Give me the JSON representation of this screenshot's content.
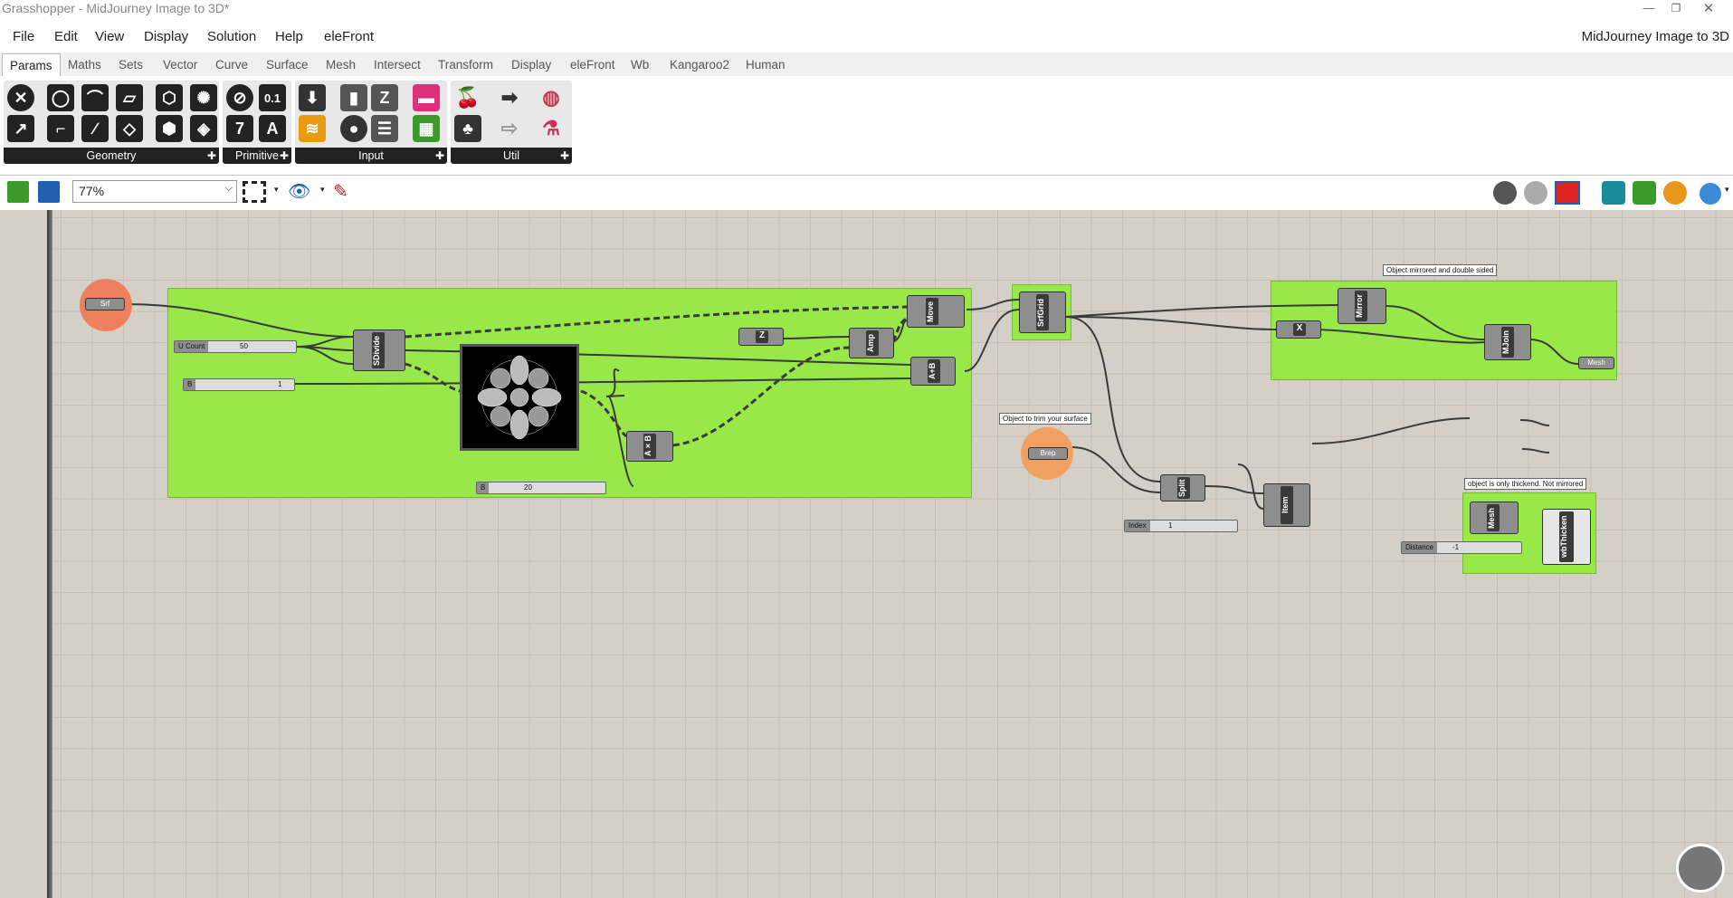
{
  "window": {
    "title": "Grasshopper - MidJourney Image to 3D*",
    "doc_name": "MidJourney Image to 3D"
  },
  "menu": [
    "File",
    "Edit",
    "View",
    "Display",
    "Solution",
    "Help",
    "eleFront"
  ],
  "tabs": [
    "Params",
    "Maths",
    "Sets",
    "Vector",
    "Curve",
    "Surface",
    "Mesh",
    "Intersect",
    "Transform",
    "Display",
    "eleFront",
    "Wb",
    "Kangaroo2",
    "Human"
  ],
  "ribbon": {
    "groups": [
      "Geometry",
      "Primitive",
      "Input",
      "Util"
    ],
    "primitive_numeric_icon": "0.1",
    "primitive_text_icon": "A",
    "primitive_integer_icon": "7"
  },
  "toolbar": {
    "zoom": "77%"
  },
  "canvas": {
    "srf_param": "Srf",
    "brep_param": "Brep",
    "notes": [
      "Object mirrored and double sided",
      "Object to trim your surface",
      "object is only thickend. Not mirrored"
    ],
    "sliders": [
      {
        "label": "U Count",
        "value": "50"
      },
      {
        "label": "B",
        "value": "1"
      },
      {
        "label": "B",
        "value": "20"
      },
      {
        "label": "Index",
        "value": "1"
      },
      {
        "label": "Distance",
        "value": "-1"
      }
    ],
    "components": {
      "sdivide": "SDivide",
      "z": "Z",
      "amp": "Amp",
      "move": "Move",
      "aplusb": "A+B",
      "axb": "A×B",
      "srfgrid": "SrfGrid",
      "mirror": "Mirror",
      "x": "X",
      "mjoin": "MJoin",
      "mesh_out": "Mesh",
      "split": "Split",
      "item": "Item",
      "mesh": "Mesh",
      "wbthicken": "wbThicken"
    }
  }
}
